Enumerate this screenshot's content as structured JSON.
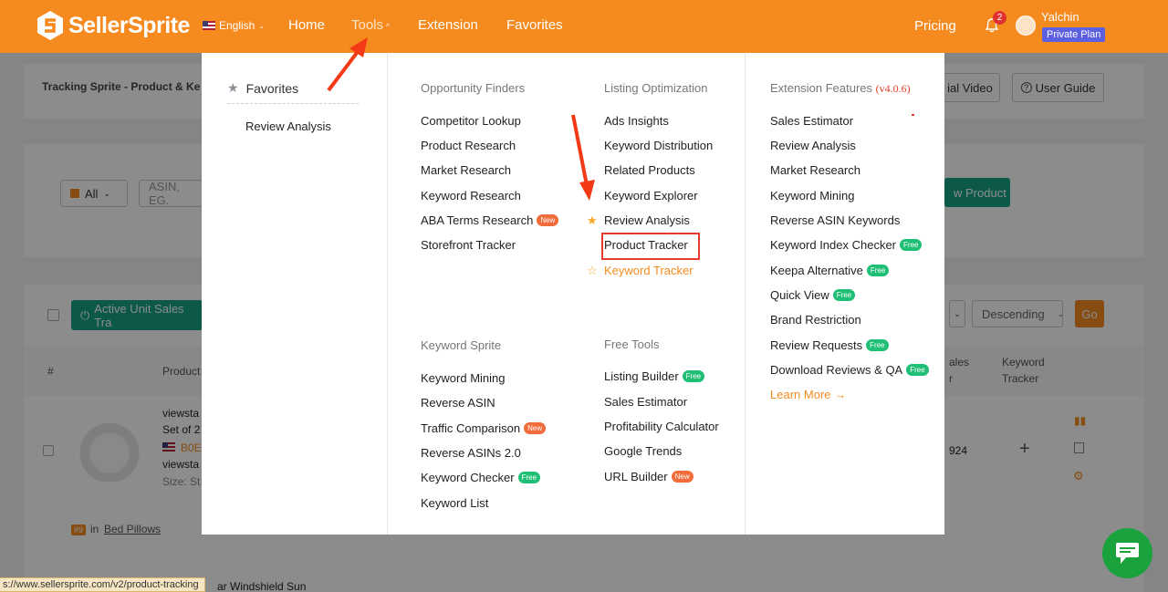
{
  "header": {
    "logo": "SellerSprite",
    "language": "English",
    "nav": [
      "Home",
      "Tools",
      "Extension",
      "Favorites"
    ],
    "pricing": "Pricing",
    "notifications": "2",
    "username": "Yalchin",
    "plan": "Private Plan"
  },
  "background": {
    "page_title": "Tracking Sprite - Product & Ke",
    "tutorial_btn": "ial Video",
    "user_guide_btn": "User Guide",
    "marketplace_select": "All",
    "asin_placeholder": "ASIN, EG.",
    "new_product_btn": "w Product",
    "active_btn": "Active Unit Sales Tra",
    "sort_select": "Descending",
    "go_btn": "Go",
    "col_index": "#",
    "col_product": "Product",
    "col_sales_1": "ales",
    "col_sales_2": "r",
    "col_keyword_tracker_1": "Keyword",
    "col_keyword_tracker_2": "Tracker",
    "row_title_1": "viewsta",
    "row_title_2": "Set of 2",
    "row_asin": "B0E",
    "row_brand": "viewsta",
    "row_size": "Size: St",
    "row_value": "924",
    "rank_badge": "#9",
    "rank_in": "in",
    "rank_category": "Bed Pillows",
    "next_row_title": "ar Windshield Sun"
  },
  "menu": {
    "favorites": {
      "heading": "Favorites",
      "items": [
        "Review Analysis"
      ]
    },
    "opportunity_finders": {
      "heading": "Opportunity Finders",
      "items": [
        "Competitor Lookup",
        "Product Research",
        "Market Research",
        "Keyword Research",
        "ABA Terms Research",
        "Storefront Tracker"
      ]
    },
    "keyword_sprite": {
      "heading": "Keyword Sprite",
      "items": [
        "Keyword Mining",
        "Reverse ASIN",
        "Traffic Comparison",
        "Reverse ASINs 2.0",
        "Keyword Checker",
        "Keyword List"
      ]
    },
    "listing_optimization": {
      "heading": "Listing Optimization",
      "items": [
        "Ads Insights",
        "Keyword Distribution",
        "Related Products",
        "Keyword Explorer",
        "Review Analysis",
        "Product Tracker",
        "Keyword Tracker"
      ]
    },
    "free_tools": {
      "heading": "Free Tools",
      "items": [
        "Listing Builder",
        "Sales Estimator",
        "Profitability Calculator",
        "Google Trends",
        "URL Builder"
      ]
    },
    "extension_features": {
      "heading": "Extension Features",
      "version": "(v4.0.6)",
      "items": [
        "Sales Estimator",
        "Review Analysis",
        "Market Research",
        "Keyword Mining",
        "Reverse ASIN Keywords",
        "Keyword Index Checker",
        "Keepa Alternative",
        "Quick View",
        "Brand Restriction",
        "Review Requests",
        "Download Reviews & QA"
      ],
      "learn_more": "Learn More"
    },
    "badges": {
      "new": "New",
      "free": "Free"
    }
  },
  "status_url": "s://www.sellersprite.com/v2/product-tracking",
  "colors": {
    "brand": "#f58a1f",
    "accent_green": "#16a085",
    "highlight": "#e53a2f",
    "arrow": "#f23a16"
  }
}
